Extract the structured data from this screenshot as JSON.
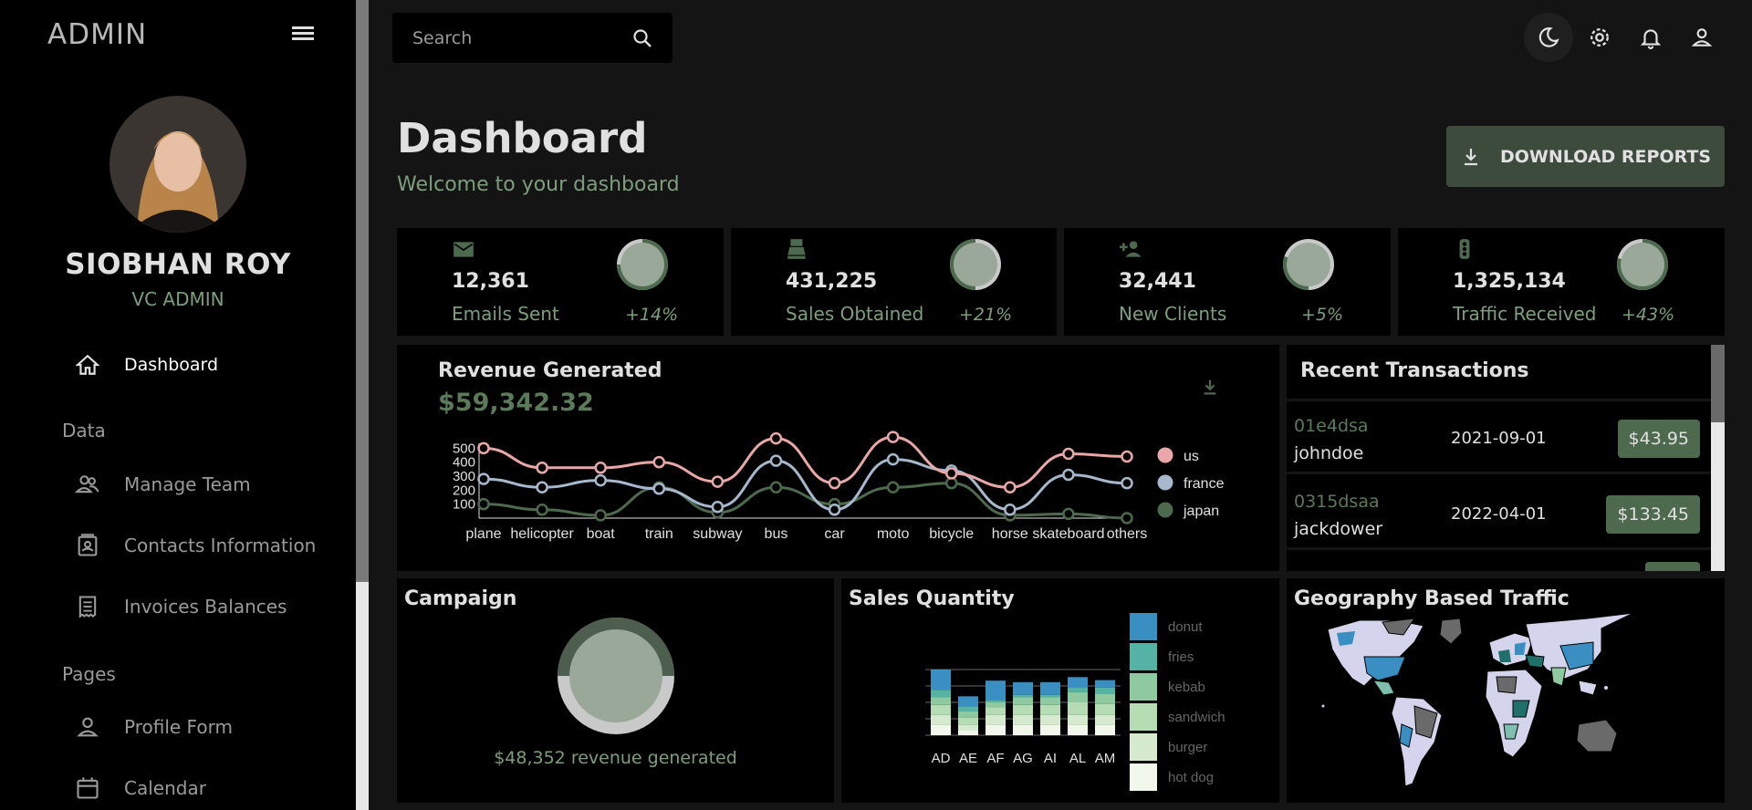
{
  "sidebar": {
    "brand": "ADMIN",
    "user_name": "SIOBHAN ROY",
    "user_role": "VC ADMIN",
    "items": [
      {
        "label": "Dashboard",
        "icon": "home-icon",
        "active": true
      },
      {
        "label": "Manage Team",
        "icon": "people-icon"
      },
      {
        "label": "Contacts Information",
        "icon": "contacts-icon"
      },
      {
        "label": "Invoices Balances",
        "icon": "receipt-icon"
      },
      {
        "label": "Profile Form",
        "icon": "person-icon"
      },
      {
        "label": "Calendar",
        "icon": "calendar-icon"
      }
    ],
    "sections": [
      "Data",
      "Pages"
    ]
  },
  "topbar": {
    "search_placeholder": "Search",
    "icons": [
      "dark-mode-icon",
      "settings-icon",
      "notifications-icon",
      "account-icon"
    ]
  },
  "header": {
    "title": "Dashboard",
    "subtitle": "Welcome to your dashboard",
    "download_label": "DOWNLOAD REPORTS"
  },
  "stats": [
    {
      "value": "12,361",
      "label": "Emails Sent",
      "increase": "+14%",
      "progress": 0.75,
      "icon": "email-icon"
    },
    {
      "value": "431,225",
      "label": "Sales Obtained",
      "increase": "+21%",
      "progress": 0.5,
      "icon": "point-of-sale-icon"
    },
    {
      "value": "32,441",
      "label": "New Clients",
      "increase": "+5%",
      "progress": 0.3,
      "icon": "person-add-icon"
    },
    {
      "value": "1,325,134",
      "label": "Traffic Received",
      "increase": "+43%",
      "progress": 0.8,
      "icon": "traffic-icon"
    }
  ],
  "revenue": {
    "title": "Revenue Generated",
    "amount": "$59,342.32"
  },
  "transactions": {
    "title": "Recent Transactions",
    "rows": [
      {
        "id": "01e4dsa",
        "user": "johndoe",
        "date": "2021-09-01",
        "cost": "$43.95"
      },
      {
        "id": "0315dsaa",
        "user": "jackdower",
        "date": "2022-04-01",
        "cost": "$133.45"
      }
    ]
  },
  "campaign": {
    "title": "Campaign",
    "subtitle": "$48,352 revenue generated",
    "progress": 0.75
  },
  "sales": {
    "title": "Sales Quantity"
  },
  "geo": {
    "title": "Geography Based Traffic"
  },
  "colors": {
    "accent_green": "#7d9e7d",
    "dark_green": "#4e6a4e",
    "us": "#e8a8a8",
    "france": "#a8b8cc",
    "japan": "#4e6a4e"
  },
  "chart_data": [
    {
      "type": "line",
      "categories": [
        "plane",
        "helicopter",
        "boat",
        "train",
        "subway",
        "bus",
        "car",
        "moto",
        "bicycle",
        "horse",
        "skateboard",
        "others"
      ],
      "yticks": [
        100,
        200,
        300,
        400,
        500
      ],
      "series": [
        {
          "name": "us",
          "color": "#e8a8a8",
          "values": [
            500,
            360,
            360,
            400,
            260,
            570,
            250,
            580,
            320,
            220,
            460,
            440
          ]
        },
        {
          "name": "france",
          "color": "#a8b8cc",
          "values": [
            280,
            220,
            270,
            210,
            80,
            410,
            60,
            420,
            340,
            60,
            310,
            250
          ]
        },
        {
          "name": "japan",
          "color": "#4e6a4e",
          "values": [
            100,
            60,
            20,
            220,
            40,
            220,
            100,
            220,
            250,
            20,
            30,
            0
          ]
        }
      ],
      "legend": "right"
    },
    {
      "type": "bar",
      "stacked": true,
      "categories": [
        "AD",
        "AE",
        "AF",
        "AG",
        "AI",
        "AL",
        "AM"
      ],
      "series": [
        {
          "name": "donut",
          "color": "#3a8fc2",
          "values": [
            40,
            20,
            38,
            25,
            25,
            20,
            15
          ]
        },
        {
          "name": "fries",
          "color": "#55b3a6",
          "values": [
            15,
            10,
            5,
            5,
            5,
            10,
            12
          ]
        },
        {
          "name": "kebab",
          "color": "#8ec9a0",
          "values": [
            15,
            12,
            10,
            15,
            15,
            20,
            20
          ]
        },
        {
          "name": "sandwich",
          "color": "#b6dcb3",
          "values": [
            20,
            15,
            15,
            20,
            20,
            25,
            22
          ]
        },
        {
          "name": "burger",
          "color": "#d6ead0",
          "values": [
            20,
            10,
            20,
            20,
            20,
            20,
            20
          ]
        },
        {
          "name": "hot dog",
          "color": "#f1f7ea",
          "values": [
            20,
            10,
            20,
            20,
            20,
            20,
            20
          ]
        }
      ],
      "legend": "right"
    }
  ]
}
